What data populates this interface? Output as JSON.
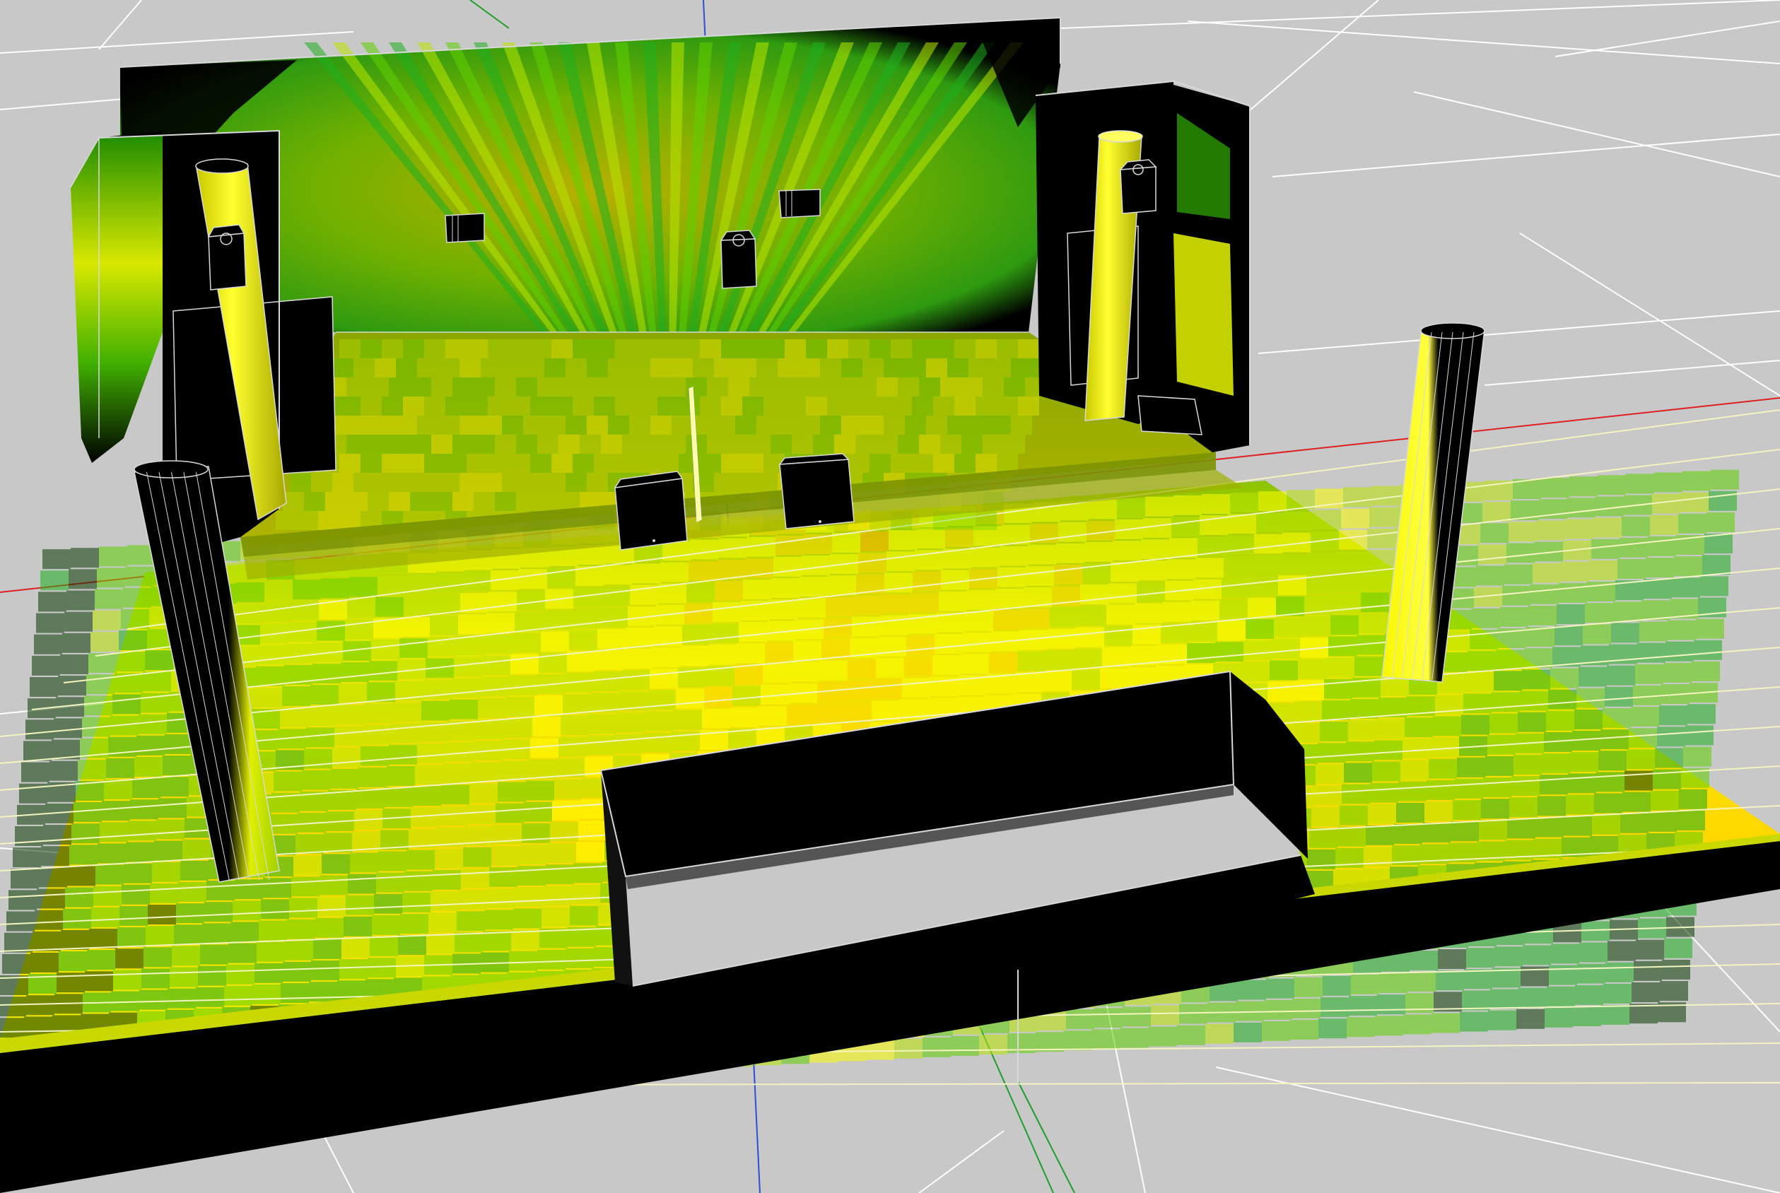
{
  "viewport": {
    "background": "#c8c8c8",
    "grid_color": "#ffffff",
    "axis_x_color": "#e02020",
    "axis_y_color": "#1f9d2a",
    "axis_z_color": "#2a4fd6"
  },
  "scene": {
    "object_color": "#000000",
    "outline_color": "#d8d8d8",
    "heatmap_palette": [
      "#0a3a00",
      "#1fae1f",
      "#5fd000",
      "#b8e600",
      "#ffff00",
      "#ffd800",
      "#ffb000"
    ],
    "icons": {
      "speaker": "speaker-icon",
      "subwoofer": "subwoofer-icon",
      "column": "column-icon",
      "wall": "wall-icon"
    }
  }
}
